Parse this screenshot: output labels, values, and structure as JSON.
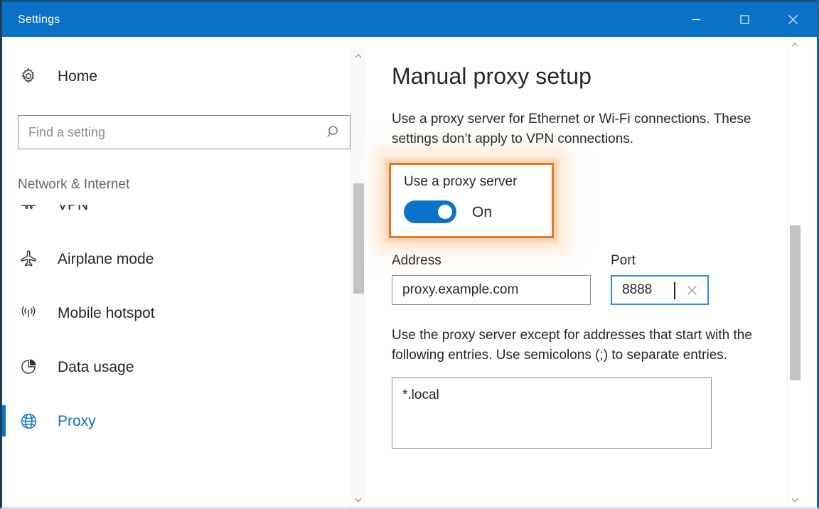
{
  "window": {
    "title": "Settings",
    "titlebar_bg": "#0a71c8",
    "minimize_label": "Minimize",
    "maximize_label": "Maximize",
    "close_label": "Close"
  },
  "sidebar": {
    "home_label": "Home",
    "search": {
      "placeholder": "Find a setting",
      "value": ""
    },
    "category": "Network & Internet",
    "items": [
      {
        "label": "VPN",
        "icon": "vpn-icon",
        "selected": false
      },
      {
        "label": "Airplane mode",
        "icon": "airplane-icon",
        "selected": false
      },
      {
        "label": "Mobile hotspot",
        "icon": "hotspot-icon",
        "selected": false
      },
      {
        "label": "Data usage",
        "icon": "data-usage-icon",
        "selected": false
      },
      {
        "label": "Proxy",
        "icon": "globe-icon",
        "selected": true
      }
    ],
    "accent_color": "#0a72c8"
  },
  "main": {
    "heading": "Manual proxy setup",
    "description": "Use a proxy server for Ethernet or Wi-Fi connections. These settings don’t apply to VPN connections.",
    "callout": {
      "highlight_color": "#e87722",
      "toggle_label": "Use a proxy server",
      "toggle_state": "On",
      "toggle_on": true
    },
    "address": {
      "label": "Address",
      "value": "proxy.example.com",
      "placeholder": ""
    },
    "port": {
      "label": "Port",
      "value": "8888",
      "placeholder": "",
      "focused": true,
      "clear_icon": "close-icon"
    },
    "exceptions": {
      "description": "Use the proxy server except for addresses that start with the following entries. Use semicolons (;) to separate entries.",
      "value": "*.local",
      "placeholder": ""
    }
  }
}
